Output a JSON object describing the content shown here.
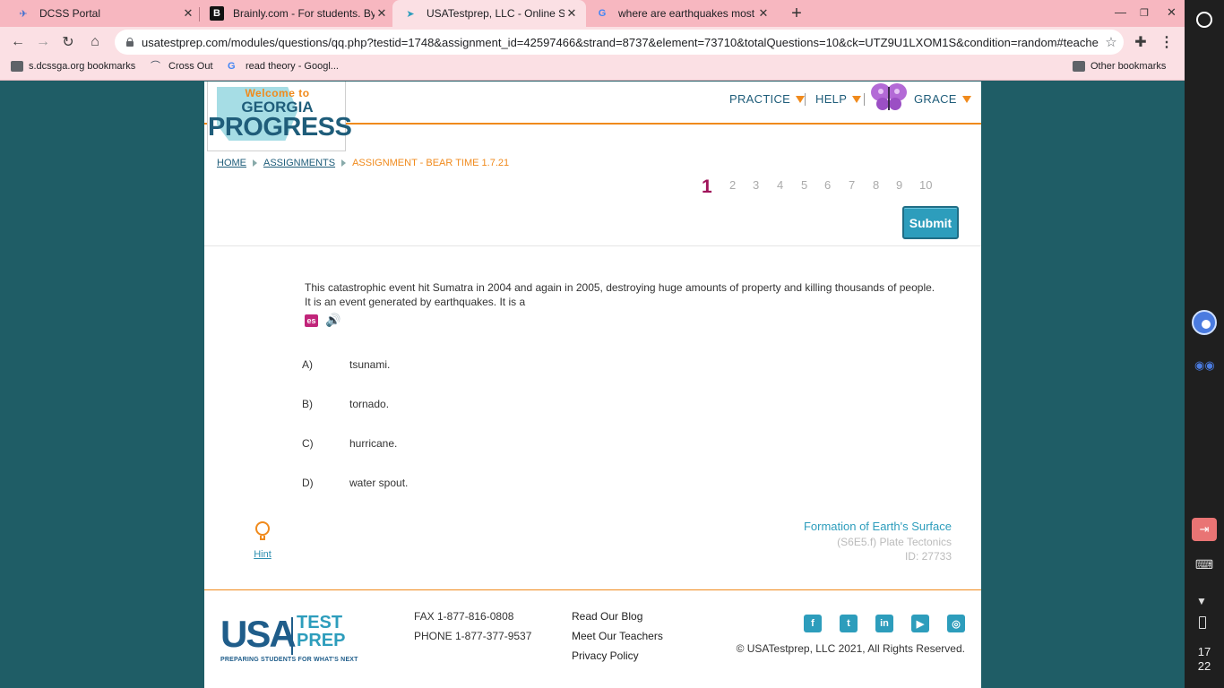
{
  "browser": {
    "tabs": [
      {
        "title": "DCSS Portal",
        "icon": "dcss-icon"
      },
      {
        "title": "Brainly.com - For students. By st",
        "icon": "brainly-icon"
      },
      {
        "title": "USATestprep, LLC - Online State-l",
        "icon": "usatestprep-icon"
      },
      {
        "title": "where are earthquakes most like",
        "icon": "google-icon"
      }
    ],
    "url": "usatestprep.com/modules/questions/qq.php?testid=1748&assignment_id=42597466&strand=8737&element=73710&totalQuestions=10&ck=UTZ9U1LXOM1S&condition=random#teacher",
    "bookmarks": [
      {
        "label": "s.dcssga.org bookmarks"
      },
      {
        "label": "Cross Out"
      },
      {
        "label": "read theory - Googl..."
      }
    ],
    "other_bookmarks": "Other bookmarks"
  },
  "shelf": {
    "clock_hour": "17",
    "clock_min": "22"
  },
  "header": {
    "logo_welcome": "Welcome to",
    "logo_georgia": "GEORGIA",
    "logo_progress": "PROGRESS",
    "nav": {
      "practice": "PRACTICE",
      "help": "HELP",
      "user": "GRACE"
    }
  },
  "breadcrumb": {
    "home": "HOME",
    "assignments": "ASSIGNMENTS",
    "current": "ASSIGNMENT - BEAR TIME 1.7.21"
  },
  "question_nav": {
    "current": "1",
    "numbers": [
      "2",
      "3",
      "4",
      "5",
      "6",
      "7",
      "8",
      "9",
      "10"
    ]
  },
  "submit_label": "Submit",
  "question": {
    "line1": "This catastrophic event hit Sumatra in 2004 and again in 2005, destroying huge amounts of property and killing thousands of people.",
    "line2": "It is an event generated by earthquakes. It is a",
    "es_label": "es"
  },
  "choices": [
    {
      "letter": "A)",
      "text": "tsunami."
    },
    {
      "letter": "B)",
      "text": "tornado."
    },
    {
      "letter": "C)",
      "text": "hurricane."
    },
    {
      "letter": "D)",
      "text": "water spout."
    }
  ],
  "hint_label": "Hint",
  "standard": {
    "title": "Formation of Earth's Surface",
    "code": "(S6E5.f) Plate Tectonics",
    "id": "ID: 27733"
  },
  "footer": {
    "logo_usa": "USA",
    "logo_test": "TEST",
    "logo_prep": "PREP",
    "logo_tag": "PREPARING STUDENTS FOR WHAT'S NEXT",
    "fax": "FAX 1-877-816-0808",
    "phone": "PHONE 1-877-377-9537",
    "links": [
      "Read Our Blog",
      "Meet Our Teachers",
      "Privacy Policy"
    ],
    "social": [
      "facebook-icon",
      "twitter-icon",
      "linkedin-icon",
      "youtube-icon",
      "instagram-icon"
    ],
    "copyright": "© USATestprep, LLC 2021, All Rights Reserved."
  },
  "colors": {
    "tabstrip": "#f7b7c0",
    "toolbar": "#fbe0e4",
    "page_bg": "#1f5d66",
    "accent_orange": "#f08a1c",
    "brand_blue": "#1f5d7a",
    "teal": "#2d9dbc",
    "question_active": "#a0135a"
  }
}
